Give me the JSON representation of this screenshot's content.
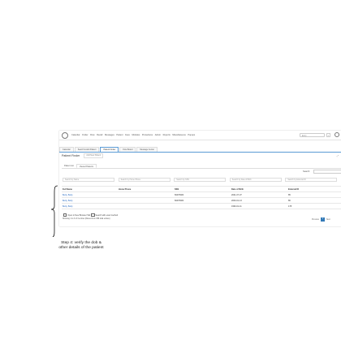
{
  "menubar": {
    "items": [
      "Calendar",
      "Finder",
      "Flow",
      "Recall",
      "Messages",
      "Patient",
      "Fees",
      "Modules",
      "Procedures",
      "Admin",
      "Reports",
      "Miscellaneous",
      "Popups"
    ],
    "search_placeholder": "Entry"
  },
  "tabs": [
    {
      "label": "Calendar",
      "active": false
    },
    {
      "label": "Search & Add Patient",
      "active": false
    },
    {
      "label": "Patient Finder",
      "active": true
    },
    {
      "label": "Flow Board",
      "active": false
    },
    {
      "label": "Message Center",
      "active": false
    }
  ],
  "page": {
    "title": "Patient Finder",
    "add_button": "Add New Patient"
  },
  "subtabs": [
    {
      "label": "Patient List",
      "active": false
    },
    {
      "label": "Viewed Patients",
      "active": true
    }
  ],
  "search_label": "Search:",
  "filters": [
    "Search by Name",
    "Search by Home Phone",
    "Search by SSN",
    "Search by Date of Birth",
    "Search by External ID"
  ],
  "table": {
    "headers": [
      "Full Name",
      "Home Phone",
      "SSN",
      "Date of Birth",
      "External ID"
    ],
    "rows": [
      [
        "Betty, Betty",
        "",
        "66478484",
        "2021-07-07",
        "85"
      ],
      [
        "Betty, Betty",
        "",
        "66478484",
        "2000-01-13",
        "86"
      ],
      [
        "Betty, Betty",
        "",
        "",
        "1990-01-11",
        "178"
      ]
    ]
  },
  "options": {
    "open_new_tab": "Open in New Browser Tab",
    "exact_method": "Search with exact method"
  },
  "footer": "Showing 1 to 3 of 3 entries (filtered from 358 total entries)",
  "pager": {
    "prev": "Previous",
    "page": "1",
    "next": "Next"
  },
  "annotation": {
    "line1": "Step 4: verify the dob &",
    "line2": "other details  of the patient"
  }
}
